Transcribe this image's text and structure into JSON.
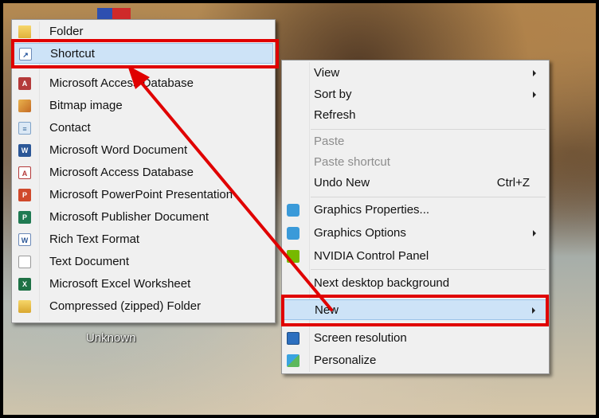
{
  "desktop": {
    "icon_label": "Unknown"
  },
  "new_submenu": {
    "items": [
      {
        "label": "Folder",
        "icon": "folder-icon"
      },
      {
        "label": "Shortcut",
        "icon": "shortcut-icon"
      },
      {
        "label": "Microsoft Access Database",
        "icon": "access-database-icon"
      },
      {
        "label": "Bitmap image",
        "icon": "bitmap-image-icon"
      },
      {
        "label": "Contact",
        "icon": "contact-icon"
      },
      {
        "label": "Microsoft Word Document",
        "icon": "word-document-icon"
      },
      {
        "label": "Microsoft Access Database",
        "icon": "access-database-icon"
      },
      {
        "label": "Microsoft PowerPoint Presentation",
        "icon": "powerpoint-icon"
      },
      {
        "label": "Microsoft Publisher Document",
        "icon": "publisher-icon"
      },
      {
        "label": "Rich Text Format",
        "icon": "rich-text-icon"
      },
      {
        "label": "Text Document",
        "icon": "text-document-icon"
      },
      {
        "label": "Microsoft Excel Worksheet",
        "icon": "excel-icon"
      },
      {
        "label": "Compressed (zipped) Folder",
        "icon": "zip-folder-icon"
      }
    ]
  },
  "context_menu": {
    "view": "View",
    "sort_by": "Sort by",
    "refresh": "Refresh",
    "paste": "Paste",
    "paste_shortcut": "Paste shortcut",
    "undo_new": "Undo New",
    "undo_new_shortcut": "Ctrl+Z",
    "graphics_properties": "Graphics Properties...",
    "graphics_options": "Graphics Options",
    "nvidia_control_panel": "NVIDIA Control Panel",
    "next_desktop_background": "Next desktop background",
    "new": "New",
    "screen_resolution": "Screen resolution",
    "personalize": "Personalize"
  },
  "colors": {
    "highlight_box": "#e00000",
    "menu_background": "#f0f0f0",
    "item_hover": "#cde3f7"
  }
}
